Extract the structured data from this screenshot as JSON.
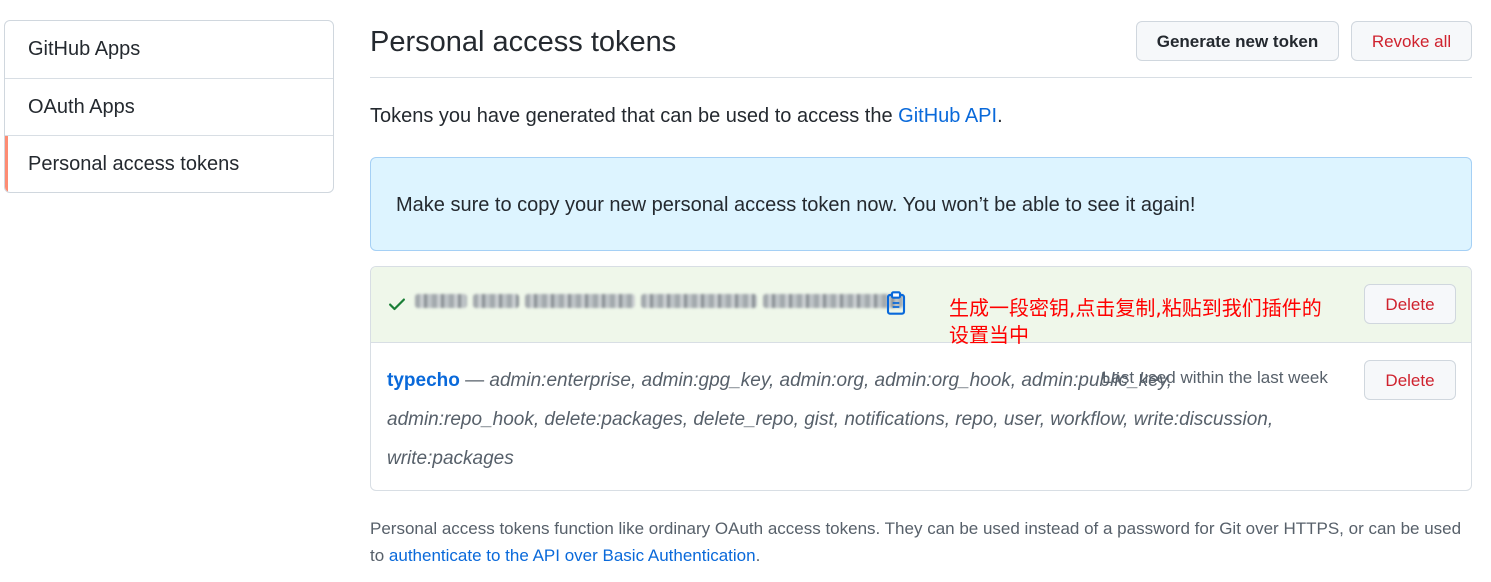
{
  "sidebar": {
    "items": [
      {
        "label": "GitHub Apps",
        "selected": false
      },
      {
        "label": "OAuth Apps",
        "selected": false
      },
      {
        "label": "Personal access tokens",
        "selected": true
      }
    ],
    "selected_color": "#fd8c73"
  },
  "header": {
    "title": "Personal access tokens",
    "generate_button": "Generate new token",
    "revoke_button": "Revoke all"
  },
  "intro": {
    "text_before": "Tokens you have generated that can be used to access the ",
    "link": "GitHub API",
    "text_after": "."
  },
  "flash": {
    "message": "Make sure to copy your new personal access token now. You won’t be able to see it again!"
  },
  "new_token": {
    "annotation_line1": "生成一段密钥,点击复制,粘贴到我们插件的",
    "annotation_line2": "设置当中",
    "delete_label": "Delete",
    "icons": {
      "check": "check-icon",
      "copy": "clipboard-icon"
    }
  },
  "token": {
    "name": "typecho",
    "separator": " — ",
    "scopes": "admin:enterprise, admin:gpg_key, admin:org, admin:org_hook, admin:public_key, admin:repo_hook, delete:packages, delete_repo, gist, notifications, repo, user, workflow, write:discussion, write:packages",
    "last_used": "Last used within the last week",
    "delete_label": "Delete"
  },
  "footnote": {
    "text_before": "Personal access tokens function like ordinary OAuth access tokens. They can be used instead of a password for Git over HTTPS, or can be used to ",
    "link": "authenticate to the API over Basic Authentication",
    "text_after": "."
  },
  "colors": {
    "link": "#0969da",
    "danger": "#cf222e",
    "flash_bg": "#ddf4ff",
    "success_bg": "#eff7ea",
    "annotation": "#ff0000"
  }
}
